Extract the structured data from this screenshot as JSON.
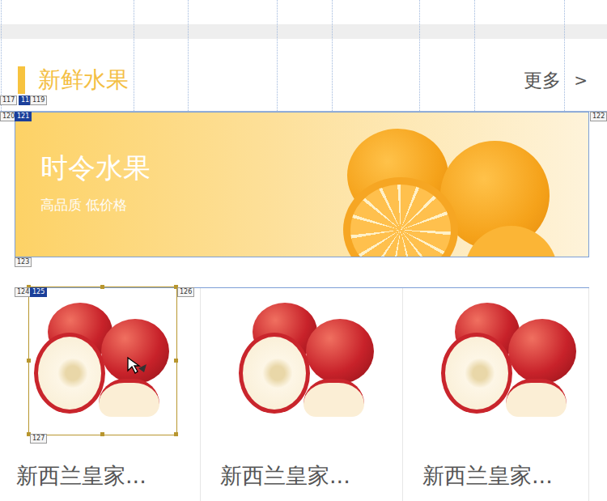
{
  "section": {
    "title": "新鲜水果",
    "more": "更多",
    "more_icon": ">"
  },
  "banner": {
    "title": "时令水果",
    "subtitle": "高品质 低价格"
  },
  "products": [
    {
      "name": "新西兰皇家...",
      "selected": true
    },
    {
      "name": "新西兰皇家...",
      "selected": false
    },
    {
      "name": "新西兰皇家...",
      "selected": false
    }
  ],
  "slices": [
    {
      "label": "117",
      "selected": false
    },
    {
      "label": "118",
      "selected": true
    },
    {
      "label": "119",
      "selected": false
    },
    {
      "label": "120",
      "selected": false
    },
    {
      "label": "121",
      "selected": true
    },
    {
      "label": "122",
      "selected": false
    },
    {
      "label": "123",
      "selected": false
    },
    {
      "label": "124",
      "selected": false
    },
    {
      "label": "125",
      "selected": true
    },
    {
      "label": "126",
      "selected": false
    },
    {
      "label": "127",
      "selected": false
    }
  ]
}
